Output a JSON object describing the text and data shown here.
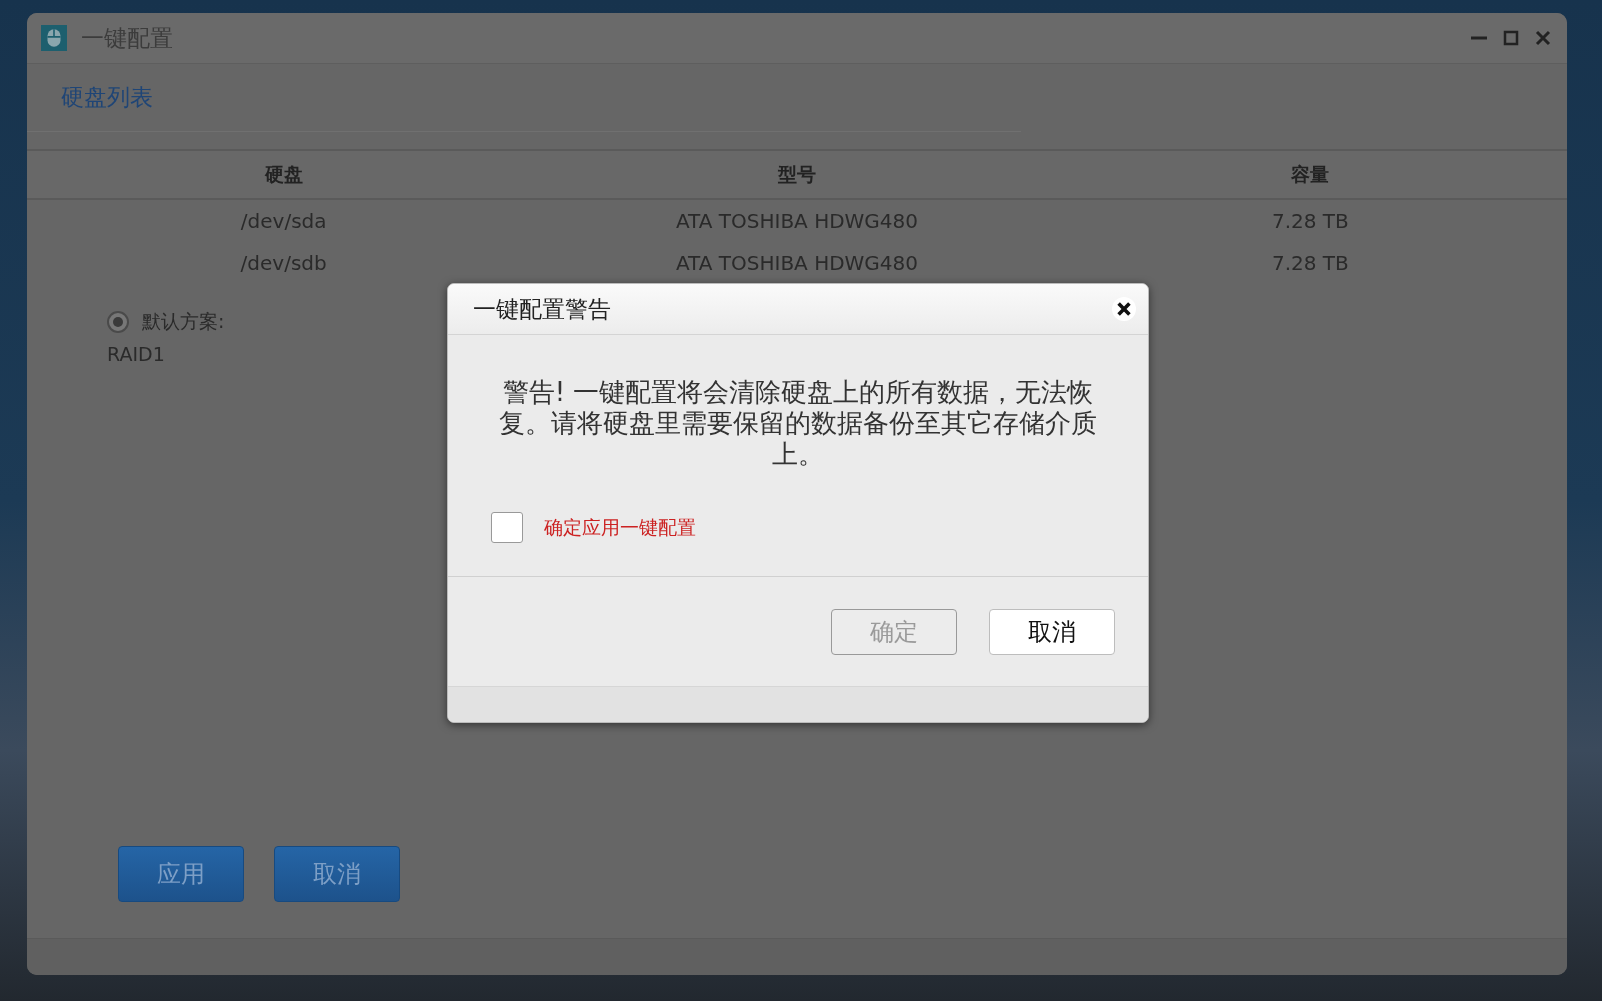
{
  "window": {
    "title": "一键配置"
  },
  "section_title": "硬盘列表",
  "table": {
    "columns": [
      "硬盘",
      "型号",
      "容量"
    ],
    "rows": [
      [
        "/dev/sda",
        "ATA TOSHIBA HDWG480",
        "7.28 TB"
      ],
      [
        "/dev/sdb",
        "ATA TOSHIBA HDWG480",
        "7.28 TB"
      ]
    ]
  },
  "scheme": {
    "label": "默认方案:",
    "selected": true,
    "value": "RAID1"
  },
  "buttons": [
    "应用",
    "取消"
  ],
  "dialog": {
    "title": "一键配置警告",
    "message": "警告! 一键配置将会清除硬盘上的所有数据，无法恢复。请将硬盘里需要保留的数据备份至其它存储介质上。",
    "checkbox": {
      "label": "确定应用一键配置",
      "checked": false
    },
    "buttons": [
      {
        "label": "确定",
        "disabled": true
      },
      {
        "label": "取消",
        "disabled": false
      }
    ]
  }
}
